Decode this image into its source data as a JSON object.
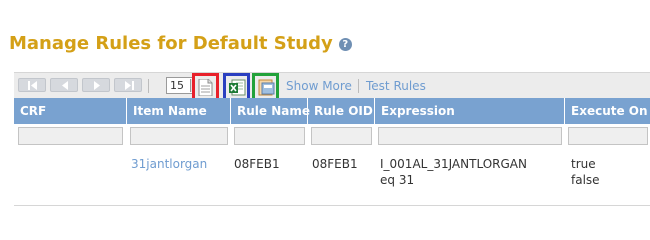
{
  "page": {
    "title": "Manage Rules for Default Study",
    "help_icon": "help-icon"
  },
  "toolbar": {
    "nav_buttons": [
      "first-page-icon",
      "previous-page-icon",
      "next-page-icon",
      "last-page-icon"
    ],
    "page_size": "15",
    "export_buttons": [
      {
        "name": "export-text-icon",
        "highlight_color": "#e8202a"
      },
      {
        "name": "export-excel-icon",
        "highlight_color": "#2a3fc0"
      },
      {
        "name": "export-pdf-icon",
        "highlight_color": "#22a23a"
      }
    ],
    "show_more_label": "Show More",
    "test_rules_label": "Test Rules"
  },
  "table": {
    "columns": [
      "CRF",
      "Item Name",
      "Rule Name",
      "Rule OID",
      "Expression",
      "Execute On"
    ],
    "rows": [
      {
        "crf": "",
        "item_name": "31jantlorgan",
        "rule_name": "08FEB1",
        "rule_oid": "08FEB1",
        "expression_line1": "I_001AL_31JANTLORGAN",
        "expression_line2": "eq 31",
        "execute_on_line1": "true",
        "execute_on_line2": "false"
      }
    ]
  },
  "colors": {
    "title": "#d4a017",
    "header_bg": "#79a2d0",
    "link": "#6f9cd0"
  }
}
